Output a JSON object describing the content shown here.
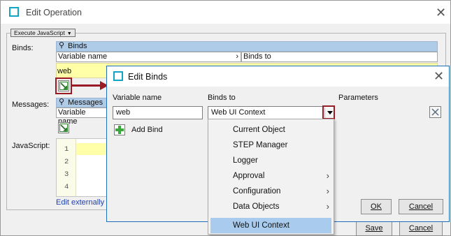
{
  "outer_window": {
    "title": "Edit Operation",
    "operation_select": "Execute JavaScript",
    "binds_label": "Binds:",
    "binds_section": "Binds",
    "binds_columns": [
      "Variable name",
      "Binds to"
    ],
    "binds_row_value": "web",
    "messages_label": "Messages:",
    "messages_section": "Messages",
    "messages_column": "Variable name",
    "javascript_label": "JavaScript:",
    "line_numbers": [
      "1",
      "2",
      "3",
      "4"
    ],
    "edit_externally": "Edit externally",
    "save_label": "Save",
    "cancel_label": "Cancel"
  },
  "dialog": {
    "title": "Edit Binds",
    "columns": {
      "variable_name": "Variable name",
      "binds_to": "Binds to",
      "parameters": "Parameters"
    },
    "variable_value": "web",
    "binds_to_value": "Web UI Context",
    "add_bind": "Add Bind",
    "ok_label": "OK",
    "cancel_label": "Cancel"
  },
  "dropdown": {
    "items": [
      {
        "label": "Current Object",
        "submenu": false
      },
      {
        "label": "STEP Manager",
        "submenu": false
      },
      {
        "label": "Logger",
        "submenu": false
      },
      {
        "label": "Approval",
        "submenu": true
      },
      {
        "label": "Configuration",
        "submenu": true
      },
      {
        "label": "Data Objects",
        "submenu": true
      }
    ],
    "selected": "Web UI Context"
  },
  "colors": {
    "accent": "#12a4c4",
    "annotation": "#9b1b24",
    "header_blue": "#aecbe8",
    "selection": "#a9ccee"
  },
  "icons": [
    "edit-operation-app-icon",
    "pin-icon",
    "add-bind-icon",
    "delete-icon",
    "close-icon",
    "submenu-arrow-icon"
  ]
}
